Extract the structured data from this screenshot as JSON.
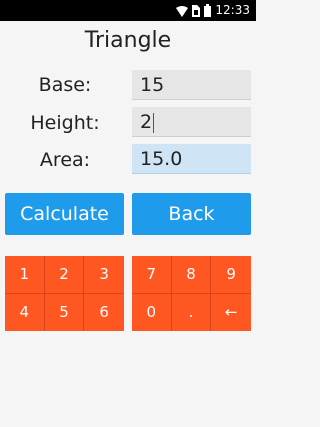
{
  "status_bar": {
    "time": "12:33",
    "icons": [
      "wifi-icon",
      "sim-icon",
      "battery-icon"
    ]
  },
  "title": "Triangle",
  "form": {
    "base_label": "Base:",
    "base_value": "15",
    "height_label": "Height:",
    "height_value": "2",
    "area_label": "Area:",
    "area_value": "15.0"
  },
  "buttons": {
    "calculate": "Calculate",
    "back": "Back"
  },
  "keypad_left": [
    "1",
    "2",
    "3",
    "4",
    "5",
    "6"
  ],
  "keypad_right": [
    "7",
    "8",
    "9",
    "0",
    ".",
    "←"
  ],
  "colors": {
    "button": "#1e9bea",
    "keypad": "#ff5722",
    "result_field": "#cfe5f5"
  }
}
